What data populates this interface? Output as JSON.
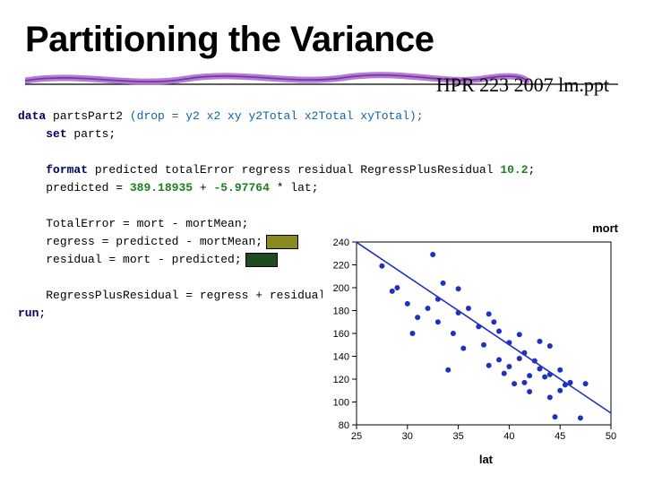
{
  "title": "Partitioning the Variance",
  "subtitle": "HPR 223 2007 lm.ppt",
  "code": {
    "l1_kw": "data",
    "l1_ds": " partsPart2 ",
    "l1_opt": "(drop = y2 x2 xy y2Total x2Total xyTotal);",
    "l2_kw": "set",
    "l2_ds": " parts;",
    "l3_kw": "format",
    "l3_rest": " predicted totalError regress residual RegressPlusResidual ",
    "l3_fmt": "10.2",
    "l3_end": ";",
    "l4": "predicted = ",
    "l4_n1": "389.18935",
    "l4_mid": " + ",
    "l4_n2": "-5.97764",
    "l4_rest": " * lat;",
    "l5": "TotalError = mort - mortMean;",
    "l6": "regress = predicted - mortMean;",
    "l7": "residual = mort - predicted;",
    "l8": "RegressPlusResidual = regress + residual;",
    "l9_kw": "run",
    "l9_end": ";"
  },
  "chart_data": {
    "type": "scatter",
    "xlabel": "lat",
    "ylabel": "mort",
    "xlim": [
      25,
      50
    ],
    "ylim": [
      80,
      240
    ],
    "xticks": [
      25,
      30,
      35,
      40,
      45,
      50
    ],
    "yticks": [
      80,
      100,
      120,
      140,
      160,
      180,
      200,
      220,
      240
    ],
    "regression": {
      "intercept": 389.18935,
      "slope": -5.97764
    },
    "points": [
      [
        27.5,
        219
      ],
      [
        28.5,
        197
      ],
      [
        29.0,
        200
      ],
      [
        30.0,
        186
      ],
      [
        30.5,
        160
      ],
      [
        31.0,
        174
      ],
      [
        32.0,
        182
      ],
      [
        32.5,
        229
      ],
      [
        33.0,
        170
      ],
      [
        33.0,
        190
      ],
      [
        33.5,
        204
      ],
      [
        34.0,
        128
      ],
      [
        34.5,
        160
      ],
      [
        35.0,
        178
      ],
      [
        35.0,
        199
      ],
      [
        35.5,
        147
      ],
      [
        36.0,
        182
      ],
      [
        37.0,
        166
      ],
      [
        37.5,
        150
      ],
      [
        38.0,
        177
      ],
      [
        38.0,
        132
      ],
      [
        38.5,
        170
      ],
      [
        39.0,
        137
      ],
      [
        39.0,
        162
      ],
      [
        39.5,
        125
      ],
      [
        40.0,
        131
      ],
      [
        40.0,
        152
      ],
      [
        40.5,
        116
      ],
      [
        41.0,
        138
      ],
      [
        41.0,
        159
      ],
      [
        41.5,
        117
      ],
      [
        41.5,
        143
      ],
      [
        42.0,
        109
      ],
      [
        42.0,
        123
      ],
      [
        42.5,
        136
      ],
      [
        43.0,
        129
      ],
      [
        43.0,
        153
      ],
      [
        43.5,
        122
      ],
      [
        44.0,
        104
      ],
      [
        44.0,
        124
      ],
      [
        44.0,
        149
      ],
      [
        44.5,
        87
      ],
      [
        45.0,
        110
      ],
      [
        45.0,
        128
      ],
      [
        45.5,
        115
      ],
      [
        46.0,
        117
      ],
      [
        47.0,
        86
      ],
      [
        47.5,
        116
      ]
    ]
  }
}
